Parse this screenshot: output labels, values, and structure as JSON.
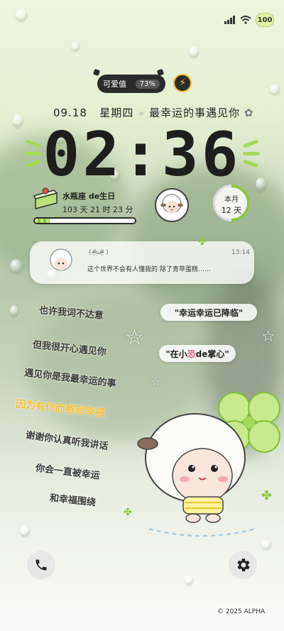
{
  "status_bar": {
    "battery": "100",
    "signal_icon": "signal-icon",
    "wifi_icon": "wifi-icon"
  },
  "cute_meter": {
    "label": "可爱值",
    "percent": "73%",
    "icon": "bolt-icon"
  },
  "date_line": {
    "date": "09.18",
    "weekday": "星期四",
    "slogan": "最幸运的事遇见你"
  },
  "clock": {
    "time": "02:36"
  },
  "birthday": {
    "title": "水瓶座 de生日",
    "countdown": "103 天 21 时 23 分",
    "progress": 0.15
  },
  "month": {
    "label": "本月",
    "days": "12 天"
  },
  "notification": {
    "emote": "( ᵒ̴̶̷̤᷄ωᵒ̴̶̷̤᷅ )",
    "time": "13:14",
    "text": "这个世界不会有人懂我的 除了青苹蛋糕……"
  },
  "tags": {
    "lucky": "\"幸运幸运已降临\"",
    "palm_prefix": "\"在小",
    "palm_mid": "恐",
    "palm_suffix": "de掌心\""
  },
  "poem": [
    "也许我词不达意",
    "但我很开心遇见你",
    "遇见你是我最幸运的事",
    "因为有你而感到幸福",
    "谢谢你认真听我讲话",
    "你会一直被幸运",
    "和幸福围绕"
  ],
  "buttons": {
    "phone_icon": "phone-icon",
    "settings_icon": "gear-icon"
  },
  "footer": {
    "copyright": "© 2025  ALPHA"
  },
  "colors": {
    "accent_green": "#a7d85a",
    "highlight_yellow": "#f4c13a",
    "dark": "#2b2b2b"
  }
}
